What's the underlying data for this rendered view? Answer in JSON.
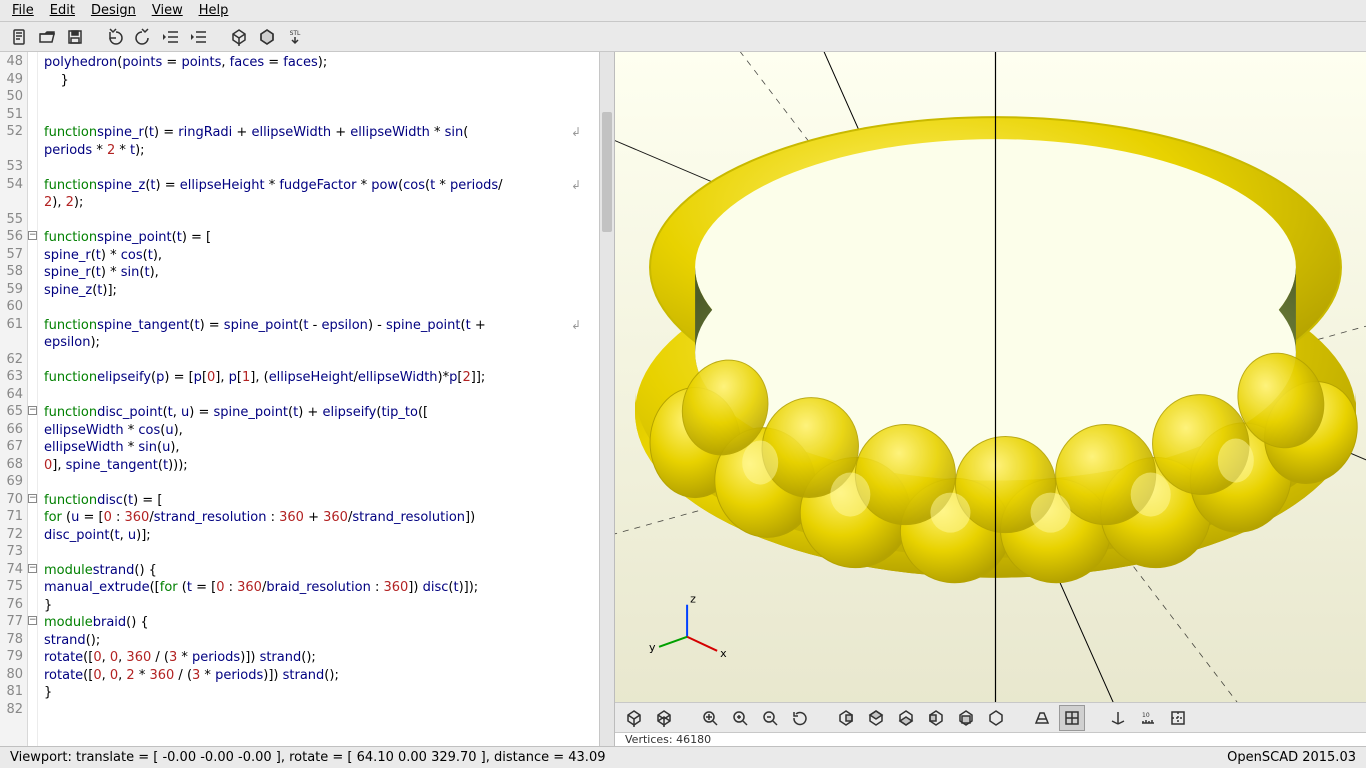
{
  "menubar": [
    "File",
    "Edit",
    "Design",
    "View",
    "Help"
  ],
  "toolbar": [
    {
      "name": "new-icon",
      "title": "New"
    },
    {
      "name": "open-icon",
      "title": "Open"
    },
    {
      "name": "save-icon",
      "title": "Save"
    },
    {
      "sep": true
    },
    {
      "name": "undo-icon",
      "title": "Undo"
    },
    {
      "name": "redo-icon",
      "title": "Redo"
    },
    {
      "name": "unindent-icon",
      "title": "Unindent"
    },
    {
      "name": "indent-icon",
      "title": "Indent"
    },
    {
      "sep": true
    },
    {
      "name": "preview-icon",
      "title": "Preview"
    },
    {
      "name": "render-icon",
      "title": "Render"
    },
    {
      "name": "export-stl-icon",
      "title": "Export STL"
    }
  ],
  "code_lines": [
    {
      "n": 48,
      "fold": "",
      "html": "        <span class='fn'>polyhedron</span>(<span class='fn'>points</span> = <span class='fn'>points</span>, <span class='fn'>faces</span> = <span class='fn'>faces</span>);"
    },
    {
      "n": 49,
      "fold": "",
      "html": "    }"
    },
    {
      "n": 50,
      "fold": "",
      "html": ""
    },
    {
      "n": 51,
      "fold": "",
      "html": ""
    },
    {
      "n": 52,
      "fold": "",
      "wrap": true,
      "html": "<span class='kw'>function</span> <span class='fn'>spine_r</span>(<span class='fn'>t</span>) = <span class='fn'>ringRadi</span> + <span class='fn'>ellipseWidth</span> + <span class='fn'>ellipseWidth</span> * <span class='fn'>sin</span>("
    },
    {
      "n": "",
      "fold": "",
      "html": "        <span class='fn'>periods</span> * <span class='num'>2</span> * <span class='fn'>t</span>);"
    },
    {
      "n": 53,
      "fold": "",
      "html": ""
    },
    {
      "n": 54,
      "fold": "",
      "wrap": true,
      "html": "<span class='kw'>function</span> <span class='fn'>spine_z</span>(<span class='fn'>t</span>) = <span class='fn'>ellipseHeight</span> * <span class='fn'>fudgeFactor</span> * <span class='fn'>pow</span>(<span class='fn'>cos</span>(<span class='fn'>t</span> * <span class='fn'>periods</span>/"
    },
    {
      "n": "",
      "fold": "",
      "html": "        <span class='num'>2</span>), <span class='num'>2</span>);"
    },
    {
      "n": 55,
      "fold": "",
      "html": ""
    },
    {
      "n": 56,
      "fold": "m",
      "html": "<span class='kw'>function</span> <span class='fn'>spine_point</span>(<span class='fn'>t</span>) = ["
    },
    {
      "n": 57,
      "fold": "",
      "html": "    <span class='fn'>spine_r</span>(<span class='fn'>t</span>) * <span class='fn'>cos</span>(<span class='fn'>t</span>),"
    },
    {
      "n": 58,
      "fold": "",
      "html": "    <span class='fn'>spine_r</span>(<span class='fn'>t</span>) * <span class='fn'>sin</span>(<span class='fn'>t</span>),"
    },
    {
      "n": 59,
      "fold": "",
      "html": "    <span class='fn'>spine_z</span>(<span class='fn'>t</span>)];"
    },
    {
      "n": 60,
      "fold": "",
      "html": ""
    },
    {
      "n": 61,
      "fold": "",
      "wrap": true,
      "html": "<span class='kw'>function</span> <span class='fn'>spine_tangent</span>(<span class='fn'>t</span>) = <span class='fn'>spine_point</span>(<span class='fn'>t</span> - <span class='fn'>epsilon</span>) - <span class='fn'>spine_point</span>(<span class='fn'>t</span> + "
    },
    {
      "n": "",
      "fold": "",
      "html": "        <span class='fn'>epsilon</span>);"
    },
    {
      "n": 62,
      "fold": "",
      "html": ""
    },
    {
      "n": 63,
      "fold": "",
      "html": "<span class='kw'>function</span> <span class='fn'>elipseify</span>(<span class='fn'>p</span>) = [<span class='fn'>p</span>[<span class='num'>0</span>], <span class='fn'>p</span>[<span class='num'>1</span>], (<span class='fn'>ellipseHeight</span>/<span class='fn'>ellipseWidth</span>)*<span class='fn'>p</span>[<span class='num'>2</span>]];"
    },
    {
      "n": 64,
      "fold": "",
      "html": ""
    },
    {
      "n": 65,
      "fold": "m",
      "html": "<span class='kw'>function</span> <span class='fn'>disc_point</span>(<span class='fn'>t</span>, <span class='fn'>u</span>) = <span class='fn'>spine_point</span>(<span class='fn'>t</span>) + <span class='fn'>elipseify</span>(<span class='fn'>tip_to</span>(["
    },
    {
      "n": 66,
      "fold": "",
      "html": "    <span class='fn'>ellipseWidth</span> * <span class='fn'>cos</span>(<span class='fn'>u</span>),"
    },
    {
      "n": 67,
      "fold": "",
      "html": "    <span class='fn'>ellipseWidth</span> * <span class='fn'>sin</span>(<span class='fn'>u</span>),"
    },
    {
      "n": 68,
      "fold": "",
      "html": "    <span class='num'>0</span>], <span class='fn'>spine_tangent</span>(<span class='fn'>t</span>)));"
    },
    {
      "n": 69,
      "fold": "",
      "html": ""
    },
    {
      "n": 70,
      "fold": "m",
      "html": "<span class='kw'>function</span> <span class='fn'>disc</span>(<span class='fn'>t</span>) = ["
    },
    {
      "n": 71,
      "fold": "",
      "html": "    <span class='kw'>for</span> (<span class='fn'>u</span> = [<span class='num'>0</span> : <span class='num'>360</span>/<span class='fn'>strand_resolution</span> : <span class='num'>360</span> + <span class='num'>360</span>/<span class='fn'>strand_resolution</span>])"
    },
    {
      "n": 72,
      "fold": "",
      "html": "        <span class='fn'>disc_point</span>(<span class='fn'>t</span>, <span class='fn'>u</span>)];"
    },
    {
      "n": 73,
      "fold": "",
      "html": ""
    },
    {
      "n": 74,
      "fold": "m",
      "html": "<span class='kw'>module</span> <span class='fn'>strand</span>() {"
    },
    {
      "n": 75,
      "fold": "",
      "html": "    <span class='fn'>manual_extrude</span>([<span class='kw'>for</span> (<span class='fn'>t</span> = [<span class='num'>0</span> : <span class='num'>360</span>/<span class='fn'>braid_resolution</span> : <span class='num'>360</span>]) <span class='fn'>disc</span>(<span class='fn'>t</span>)]);"
    },
    {
      "n": 76,
      "fold": "",
      "html": "}"
    },
    {
      "n": 77,
      "fold": "m",
      "html": "<span class='kw'>module</span> <span class='fn'>braid</span>() {"
    },
    {
      "n": 78,
      "fold": "",
      "html": "    <span class='fn'>strand</span>();"
    },
    {
      "n": 79,
      "fold": "",
      "html": "    <span class='fn'>rotate</span>([<span class='num'>0</span>, <span class='num'>0</span>, <span class='num'>360</span> / (<span class='num'>3</span> * <span class='fn'>periods</span>)]) <span class='fn'>strand</span>();"
    },
    {
      "n": 80,
      "fold": "",
      "html": "    <span class='fn'>rotate</span>([<span class='num'>0</span>, <span class='num'>0</span>, <span class='num'>2</span> * <span class='num'>360</span> / (<span class='num'>3</span> * <span class='fn'>periods</span>)]) <span class='fn'>strand</span>();"
    },
    {
      "n": 81,
      "fold": "",
      "html": "}"
    },
    {
      "n": 82,
      "fold": "",
      "html": ""
    }
  ],
  "viewbar": [
    {
      "name": "preview-icon",
      "title": "Preview"
    },
    {
      "name": "wireframe-icon",
      "title": "Surfaces"
    },
    {
      "gap": true
    },
    {
      "name": "zoom-fit-icon",
      "title": "View All"
    },
    {
      "name": "zoom-in-icon",
      "title": "Zoom In"
    },
    {
      "name": "zoom-out-icon",
      "title": "Zoom Out"
    },
    {
      "name": "reset-view-icon",
      "title": "Reset View"
    },
    {
      "gap": true
    },
    {
      "name": "view-right-icon",
      "title": "Right"
    },
    {
      "name": "view-top-icon",
      "title": "Top"
    },
    {
      "name": "view-bottom-icon",
      "title": "Bottom"
    },
    {
      "name": "view-left-icon",
      "title": "Left"
    },
    {
      "name": "view-front-icon",
      "title": "Front"
    },
    {
      "name": "view-back-icon",
      "title": "Back"
    },
    {
      "gap": true
    },
    {
      "name": "perspective-icon",
      "title": "Perspective"
    },
    {
      "name": "ortho-icon",
      "title": "Orthogonal",
      "active": true
    },
    {
      "gap": true
    },
    {
      "name": "show-axes-icon",
      "title": "Show Axes"
    },
    {
      "name": "show-scale-icon",
      "title": "Show Scale"
    },
    {
      "name": "show-crosshairs-icon",
      "title": "Show Crosshairs"
    }
  ],
  "axes": {
    "x": "x",
    "y": "y",
    "z": "z"
  },
  "console_peek": "Vertices:  46180",
  "statusbar": {
    "left": "Viewport: translate = [ -0.00 -0.00 -0.00 ], rotate = [ 64.10 0.00 329.70 ], distance = 43.09",
    "right": "OpenSCAD 2015.03"
  }
}
